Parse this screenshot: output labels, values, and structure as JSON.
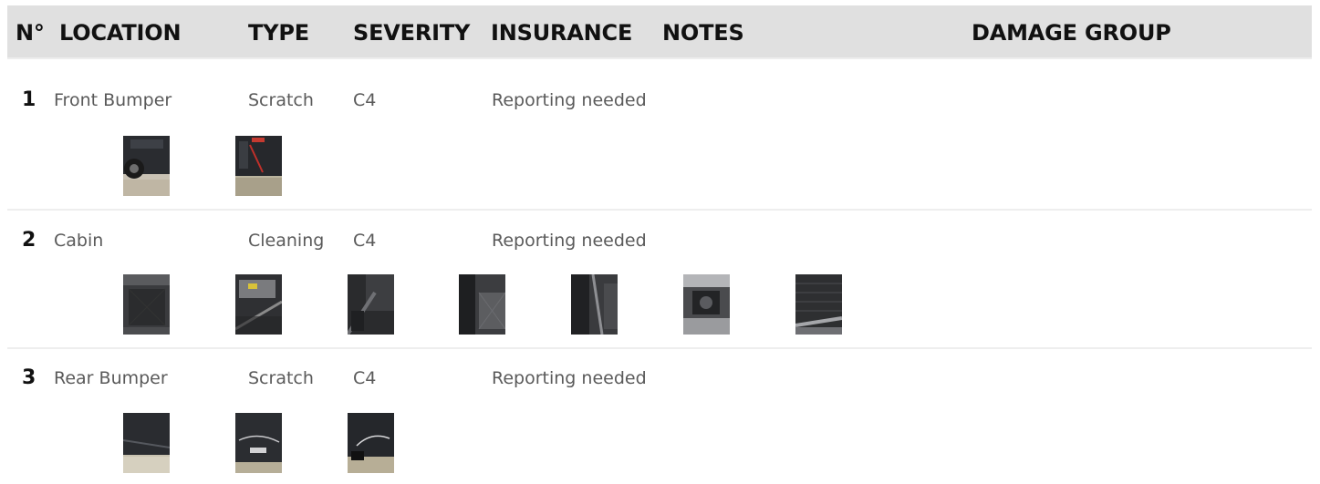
{
  "table": {
    "headers": {
      "number": "N°",
      "location": "LOCATION",
      "type": "TYPE",
      "severity": "SEVERITY",
      "insurance": "INSURANCE",
      "notes": "NOTES",
      "damage_group": "DAMAGE GROUP"
    },
    "rows": [
      {
        "number": "1",
        "location": "Front Bumper",
        "type": "Scratch",
        "severity": "C4",
        "insurance": "Reporting needed",
        "notes": "",
        "damage_group": "",
        "photos": [
          "front-bumper-wheel-photo",
          "front-bumper-door-sill-photo"
        ]
      },
      {
        "number": "2",
        "location": "Cabin",
        "type": "Cleaning",
        "severity": "C4",
        "insurance": "Reporting needed",
        "notes": "",
        "damage_group": "",
        "photos": [
          "trunk-floor-photo",
          "under-seat-photo",
          "seat-rail-photo",
          "rear-floor-mat-photo",
          "door-sill-photo",
          "center-console-photo",
          "floor-mat-photo"
        ]
      },
      {
        "number": "3",
        "location": "Rear Bumper",
        "type": "Scratch",
        "severity": "C4",
        "insurance": "Reporting needed",
        "notes": "",
        "damage_group": "",
        "photos": [
          "rear-bumper-photo",
          "rear-bumper-closeup-photo",
          "rear-bumper-side-photo"
        ]
      }
    ]
  }
}
